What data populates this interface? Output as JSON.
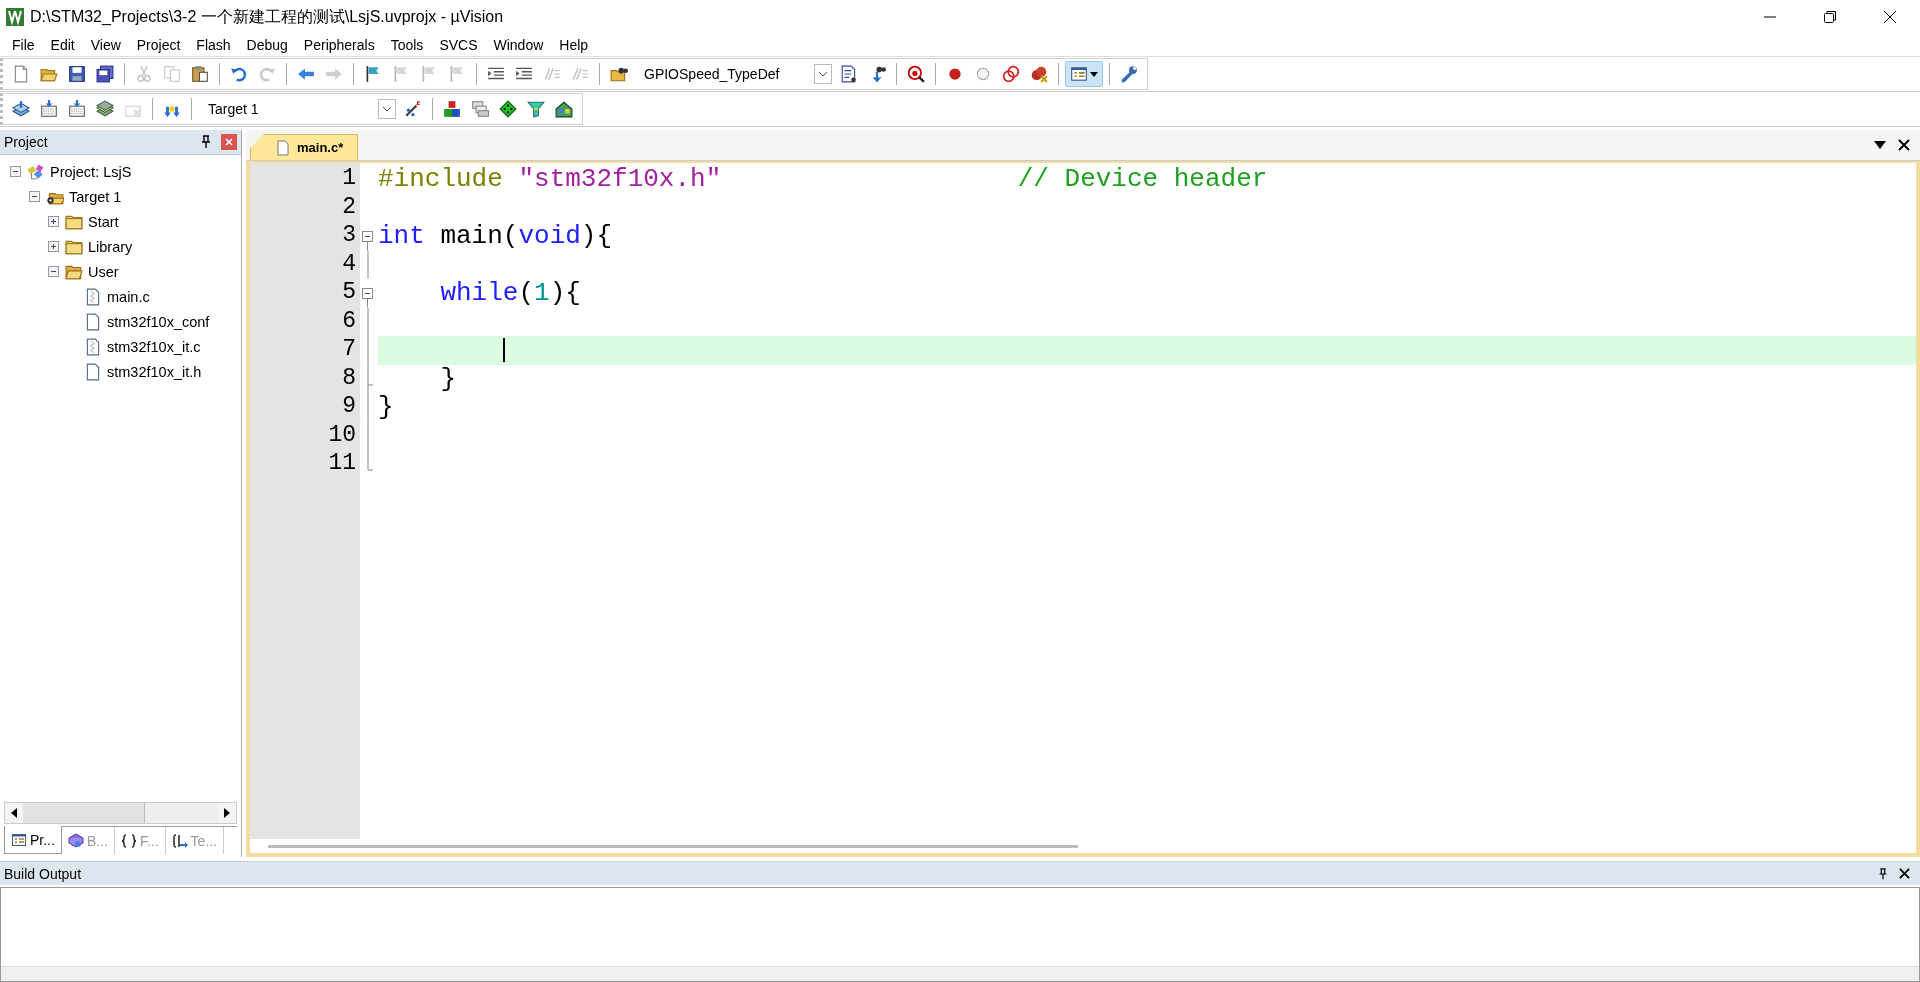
{
  "window": {
    "title": "D:\\STM32_Projects\\3-2 一个新建工程的测试\\LsjS.uvprojx - µVision"
  },
  "menu": [
    "File",
    "Edit",
    "View",
    "Project",
    "Flash",
    "Debug",
    "Peripherals",
    "Tools",
    "SVCS",
    "Window",
    "Help"
  ],
  "toolbar_1": [
    {
      "kind": "new",
      "disabled": false
    },
    {
      "kind": "open",
      "disabled": false
    },
    {
      "kind": "save",
      "disabled": false
    },
    {
      "kind": "save-all",
      "disabled": false
    },
    {
      "kind": "separator"
    },
    {
      "kind": "cut",
      "disabled": true
    },
    {
      "kind": "copy",
      "disabled": true
    },
    {
      "kind": "paste",
      "disabled": false
    },
    {
      "kind": "separator"
    },
    {
      "kind": "undo",
      "disabled": false
    },
    {
      "kind": "redo",
      "disabled": true
    },
    {
      "kind": "separator"
    },
    {
      "kind": "back",
      "disabled": false
    },
    {
      "kind": "forward",
      "disabled": true
    },
    {
      "kind": "separator"
    },
    {
      "kind": "bookmark",
      "disabled": false
    },
    {
      "kind": "bookmark",
      "disabled": true
    },
    {
      "kind": "bookmark",
      "disabled": true
    },
    {
      "kind": "bookmark",
      "disabled": true
    },
    {
      "kind": "separator"
    },
    {
      "kind": "indent",
      "disabled": false
    },
    {
      "kind": "indent",
      "disabled": false
    },
    {
      "kind": "comment",
      "disabled": true
    },
    {
      "kind": "comment",
      "disabled": true
    },
    {
      "kind": "separator"
    },
    {
      "kind": "find-files",
      "disabled": false
    },
    {
      "kind": "combo",
      "value": "GPIOSpeed_TypeDef"
    },
    {
      "kind": "find",
      "disabled": false
    },
    {
      "kind": "references",
      "disabled": false
    },
    {
      "kind": "separator"
    },
    {
      "kind": "debug",
      "disabled": false
    },
    {
      "kind": "separator"
    },
    {
      "kind": "breakpoint",
      "disabled": false
    },
    {
      "kind": "breakpoint-off",
      "disabled": false
    },
    {
      "kind": "breakpoints",
      "disabled": false
    },
    {
      "kind": "breakpoint-kill",
      "disabled": false
    },
    {
      "kind": "separator"
    },
    {
      "kind": "layout",
      "disabled": false
    },
    {
      "kind": "separator"
    },
    {
      "kind": "wrench",
      "disabled": false
    }
  ],
  "window_layout_button": {
    "pressed": true
  },
  "toolbar_2": [
    {
      "kind": "translate",
      "disabled": false
    },
    {
      "kind": "build",
      "disabled": false
    },
    {
      "kind": "build",
      "disabled": false
    },
    {
      "kind": "batch",
      "disabled": false
    },
    {
      "kind": "stop",
      "disabled": true
    },
    {
      "kind": "separator"
    },
    {
      "kind": "load",
      "disabled": false
    },
    {
      "kind": "separator"
    },
    {
      "kind": "combo",
      "value": "Target 1"
    },
    {
      "kind": "wand",
      "disabled": false
    },
    {
      "kind": "separator"
    },
    {
      "kind": "components",
      "disabled": false
    },
    {
      "kind": "windows",
      "disabled": false
    },
    {
      "kind": "diamond",
      "disabled": false
    },
    {
      "kind": "filter",
      "disabled": false
    },
    {
      "kind": "pack",
      "disabled": false
    }
  ],
  "project_panel": {
    "title": "Project",
    "tree": [
      {
        "label": "Project: LsjS",
        "kind": "project",
        "expanded": true,
        "children": [
          {
            "label": "Target 1",
            "kind": "target",
            "expanded": true,
            "children": [
              {
                "label": "Start",
                "kind": "group",
                "expanded": false
              },
              {
                "label": "Library",
                "kind": "group",
                "expanded": false
              },
              {
                "label": "User",
                "kind": "group",
                "expanded": true,
                "children": [
                  {
                    "label": "main.c",
                    "kind": "c-file"
                  },
                  {
                    "label": "stm32f10x_conf",
                    "kind": "h-file"
                  },
                  {
                    "label": "stm32f10x_it.c",
                    "kind": "c-file"
                  },
                  {
                    "label": "stm32f10x_it.h",
                    "kind": "h-file"
                  }
                ]
              }
            ]
          }
        ]
      }
    ],
    "tabs": [
      {
        "label": "Pr...",
        "kind": "project",
        "selected": true
      },
      {
        "label": "B...",
        "kind": "books",
        "selected": false
      },
      {
        "label": "F...",
        "kind": "functions",
        "selected": false
      },
      {
        "label": "Te...",
        "kind": "templates",
        "selected": false
      }
    ]
  },
  "editor": {
    "tabs": [
      {
        "label": "main.c*",
        "selected": true
      }
    ],
    "lines": [
      {
        "number": "1",
        "kind": "plain",
        "current": false,
        "tokens": [
          {
            "kind": "preprocessor",
            "text": "#include "
          },
          {
            "kind": "string",
            "text": "\"stm32f10x.h\""
          },
          {
            "kind": "comment",
            "text": "                   // Device header"
          }
        ]
      },
      {
        "number": "2",
        "kind": "plain",
        "current": false
      },
      {
        "number": "3",
        "kind": "fold-start",
        "current": false,
        "tokens": [
          {
            "kind": "keyword",
            "text": "int"
          },
          {
            "kind": "plain",
            "text": " main("
          },
          {
            "kind": "keyword",
            "text": "void"
          },
          {
            "kind": "plain",
            "text": "){"
          }
        ]
      },
      {
        "number": "4",
        "kind": "fold-line",
        "current": false
      },
      {
        "number": "5",
        "kind": "fold-start",
        "current": false,
        "tokens": [
          {
            "kind": "keyword",
            "text": "    while"
          },
          {
            "kind": "plain",
            "text": "("
          },
          {
            "kind": "number",
            "text": "1"
          },
          {
            "kind": "plain",
            "text": "){"
          }
        ]
      },
      {
        "number": "6",
        "kind": "fold-line",
        "current": false
      },
      {
        "number": "7",
        "kind": "fold-line",
        "current": true
      },
      {
        "number": "8",
        "kind": "fold-end",
        "current": false,
        "tokens": [
          {
            "kind": "plain",
            "text": "    }"
          }
        ]
      },
      {
        "number": "9",
        "kind": "fold-line",
        "current": false,
        "tokens": [
          {
            "kind": "plain",
            "text": "}"
          }
        ]
      },
      {
        "number": "10",
        "kind": "fold-line",
        "current": false
      },
      {
        "number": "11",
        "kind": "fold-end",
        "current": false
      }
    ]
  },
  "build_output": {
    "title": "Build Output"
  }
}
